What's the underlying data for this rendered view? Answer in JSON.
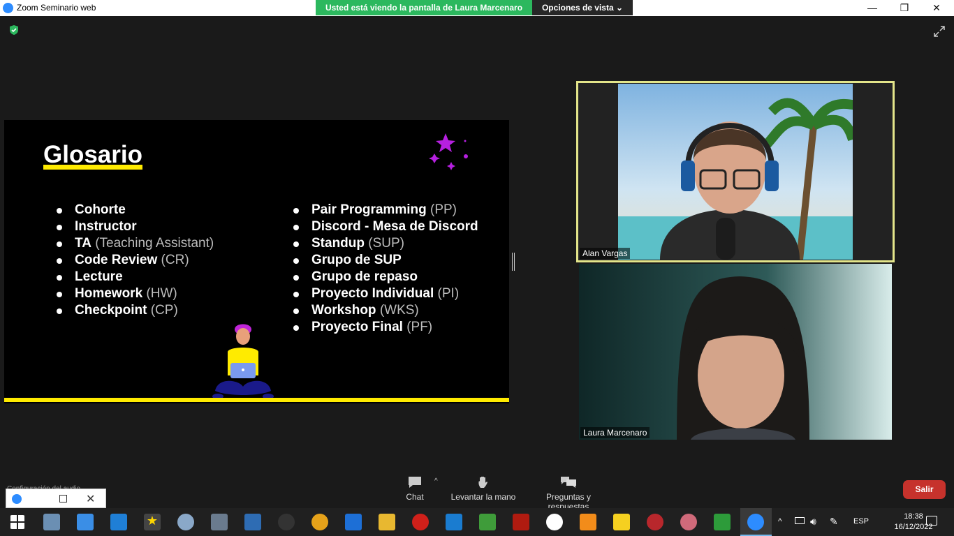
{
  "window": {
    "app_title": "Zoom Seminario web",
    "share_banner": "Usted está viendo la pantalla de Laura Marcenaro",
    "view_options": "Opciones de vista",
    "minimize": "—",
    "restore": "❐",
    "close": "✕"
  },
  "slide": {
    "title": "Glosario",
    "left_items": [
      {
        "term": "Cohorte",
        "abbr": ""
      },
      {
        "term": "Instructor",
        "abbr": ""
      },
      {
        "term": "TA",
        "abbr": " (Teaching Assistant)"
      },
      {
        "term": "Code Review",
        "abbr": " (CR)"
      },
      {
        "term": "Lecture",
        "abbr": ""
      },
      {
        "term": "Homework",
        "abbr": " (HW)"
      },
      {
        "term": "Checkpoint",
        "abbr": " (CP)"
      }
    ],
    "right_items": [
      {
        "term": "Pair Programming",
        "abbr": " (PP)"
      },
      {
        "term": "Discord - Mesa de Discord",
        "abbr": ""
      },
      {
        "term": "Standup",
        "abbr": " (SUP)"
      },
      {
        "term": "Grupo de SUP",
        "abbr": ""
      },
      {
        "term": "Grupo de repaso",
        "abbr": ""
      },
      {
        "term": "Proyecto Individual",
        "abbr": " (PI)"
      },
      {
        "term": "Workshop",
        "abbr": " (WKS)"
      },
      {
        "term": "Proyecto Final",
        "abbr": " (PF)"
      }
    ],
    "accent_color": "#ffeb00",
    "star_color": "#b620e0"
  },
  "participants": {
    "alan": "Alan Vargas",
    "laura": "Laura Marcenaro"
  },
  "controls": {
    "chat": "Chat",
    "raise_hand": "Levantar la mano",
    "qa": "Preguntas y respuestas",
    "exit": "Salir",
    "audio_hint": "Configuración del audio"
  },
  "taskbar": {
    "language": "ESP",
    "time": "18:38",
    "date": "16/12/2022"
  }
}
